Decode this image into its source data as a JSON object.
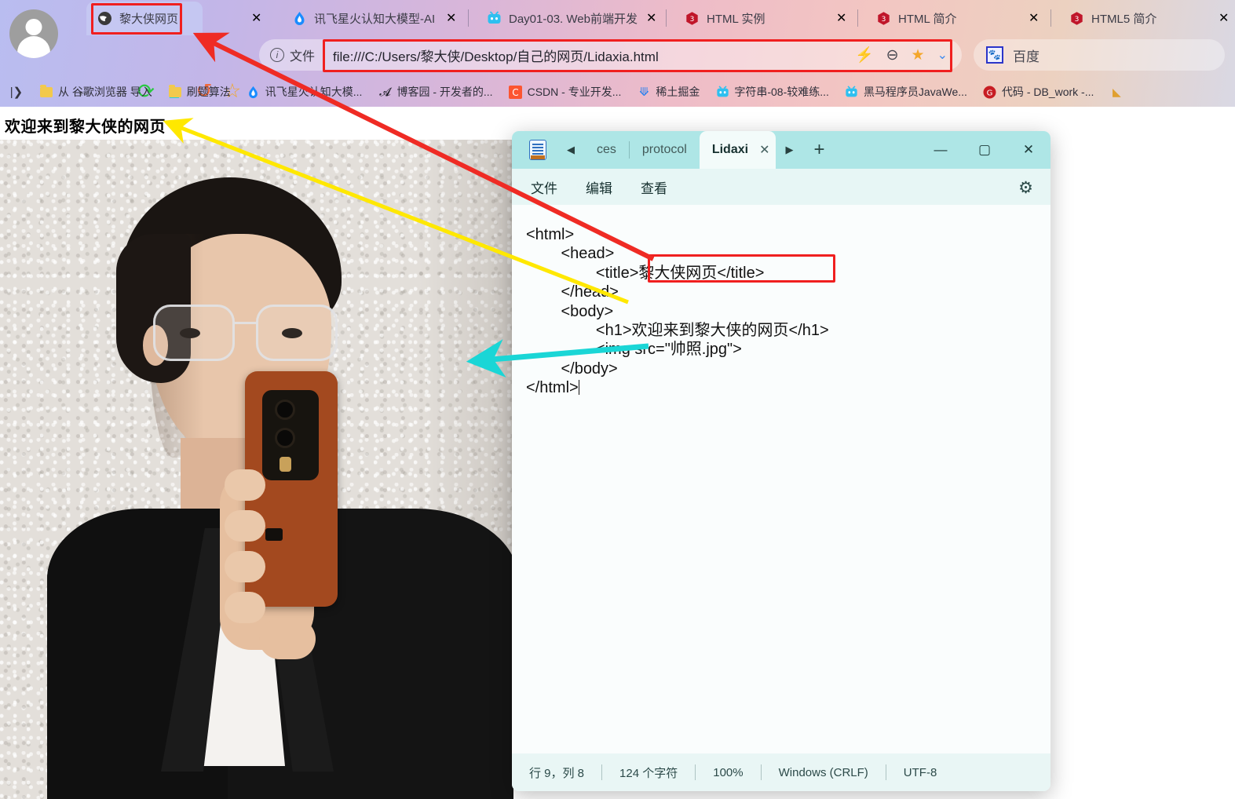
{
  "browser": {
    "tabs": [
      {
        "title": "黎大侠网页",
        "favicon": "globe-icon",
        "active": true
      },
      {
        "title": "讯飞星火认知大模型-AI大",
        "favicon": "spark-icon",
        "active": false
      },
      {
        "title": "Day01-03. Web前端开发",
        "favicon": "bilibili-icon",
        "active": false
      },
      {
        "title": "HTML 实例",
        "favicon": "runoob-icon",
        "active": false
      },
      {
        "title": "HTML 简介",
        "favicon": "runoob-icon",
        "active": false
      },
      {
        "title": "HTML5 简介",
        "favicon": "runoob-icon",
        "active": false
      }
    ],
    "tab_close_label": "✕",
    "nav": {
      "back": "←",
      "forward": "→",
      "reload": "⟳",
      "home": "⌂",
      "history": "↺",
      "bookmark_star": "☆"
    },
    "urlbar": {
      "scheme_label": "文件",
      "info_icon": "i",
      "url": "file:///C:/Users/黎大侠/Desktop/自己的网页/Lidaxia.html",
      "icons": [
        "lightning-icon",
        "zoom-out-icon",
        "star-icon",
        "chevron-down-icon"
      ]
    },
    "search": {
      "engine_label": "百度",
      "icon": "baidu-paw-icon"
    },
    "bookmarks": [
      {
        "label": "从 谷歌浏览器 导入",
        "icon": "folder-icon"
      },
      {
        "label": "刷题算法",
        "icon": "folder-icon"
      },
      {
        "label": "讯飞星火认知大模...",
        "icon": "spark-icon"
      },
      {
        "label": "博客园 - 开发者的...",
        "icon": "cnblogs-icon"
      },
      {
        "label": "CSDN - 专业开发...",
        "icon": "csdn-icon"
      },
      {
        "label": "稀土掘金",
        "icon": "juejin-icon"
      },
      {
        "label": "字符串-08-较难练...",
        "icon": "bilibili-icon"
      },
      {
        "label": "黑马程序员JavaWe...",
        "icon": "bilibili-icon"
      },
      {
        "label": "代码 - DB_work -...",
        "icon": "gitee-icon"
      }
    ],
    "bookmarks_overflow_icon": "chevron-left-icon"
  },
  "webpage": {
    "heading": "欢迎来到黎大侠的网页",
    "image_alt": "帅照.jpg"
  },
  "notepad": {
    "app_icon": "notepad-icon",
    "prev_arrow": "◀",
    "next_arrow": "▶",
    "new_tab": "+",
    "tabs": [
      {
        "title": "ces",
        "active": false
      },
      {
        "title": "protocol",
        "active": false
      },
      {
        "title": "Lidaxi",
        "active": true,
        "close": "✕"
      }
    ],
    "window_controls": {
      "minimize": "—",
      "maximize": "▢",
      "close": "✕"
    },
    "menus": [
      "文件",
      "编辑",
      "查看"
    ],
    "settings_icon": "gear-icon",
    "code_lines": [
      "<html>",
      "        <head>",
      "                <title>黎大侠网页</title>",
      "        </head>",
      "        <body>",
      "                <h1>欢迎来到黎大侠的网页</h1>",
      "                <img src=\"帅照.jpg\">",
      "        </body>",
      "</html>"
    ],
    "statusbar": {
      "position": "行 9，列 8",
      "chars": "124 个字符",
      "zoom": "100%",
      "line_ending": "Windows (CRLF)",
      "encoding": "UTF-8"
    }
  },
  "annotations": {
    "highlight_color": "#f01f1f",
    "arrow_red": "#ef2b24",
    "arrow_yellow": "#ffe800",
    "arrow_cyan": "#1ad6d6",
    "boxes": [
      "tab-title-box",
      "url-box",
      "url-icons-box",
      "title-tag-box"
    ]
  }
}
